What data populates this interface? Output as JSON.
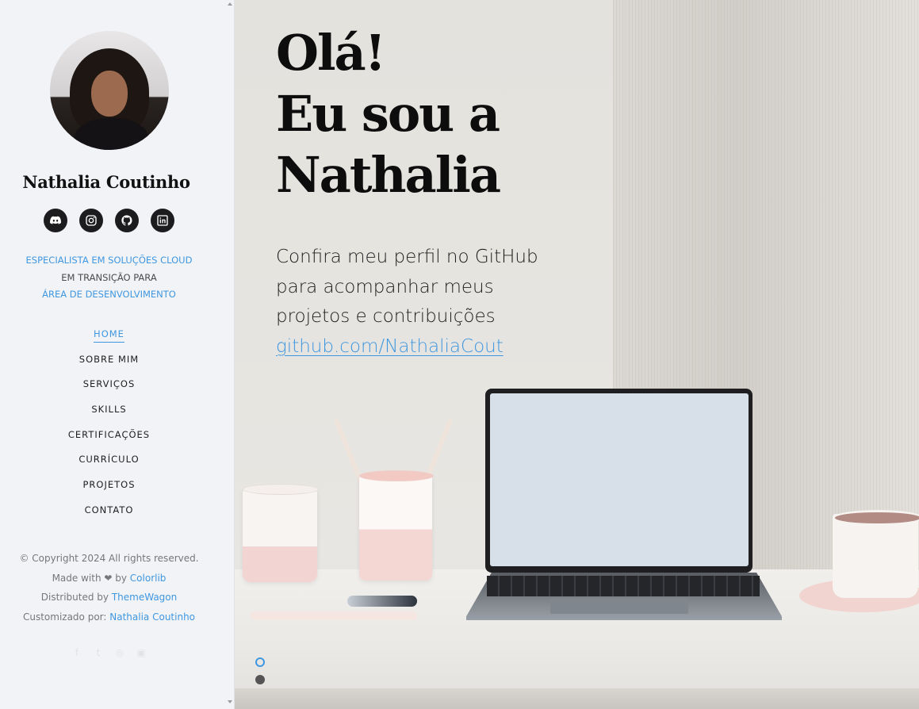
{
  "profile": {
    "name": "Nathalia Coutinho"
  },
  "social": [
    {
      "icon": "discord-icon"
    },
    {
      "icon": "instagram-icon"
    },
    {
      "icon": "github-icon"
    },
    {
      "icon": "linkedin-icon"
    }
  ],
  "tagline": {
    "line1": "ESPECIALISTA EM SOLUÇÕES CLOUD",
    "line2": "EM TRANSIÇÃO PARA",
    "line3": "ÁREA DE DESENVOLVIMENTO"
  },
  "nav": [
    {
      "label": "HOME",
      "active": true
    },
    {
      "label": "SOBRE MIM"
    },
    {
      "label": "SERVIÇOS"
    },
    {
      "label": "SKILLS"
    },
    {
      "label": "CERTIFICAÇÕES"
    },
    {
      "label": "CURRÍCULO"
    },
    {
      "label": "PROJETOS"
    },
    {
      "label": "CONTATO"
    }
  ],
  "footer": {
    "copyright": "© Copyright 2024 All rights reserved.",
    "made_with": "Made with ❤ by",
    "made_with_link": "Colorlib",
    "distributed": "Distributed by",
    "distributed_link": "ThemeWagon",
    "custom": "Customizado por:",
    "custom_link": "Nathalia Coutinho"
  },
  "hero": {
    "greeting": "Olá!",
    "line2": "Eu sou a",
    "line3": "Nathalia",
    "text1": "Confira meu perfil no GitHub",
    "text2": "para acompanhar meus",
    "text3": "projetos e contribuições",
    "link": "github.com/NathaliaCout"
  },
  "colors": {
    "accent": "#3f97e0",
    "sidebar_bg": "#f2f3f7",
    "text": "#111111"
  }
}
